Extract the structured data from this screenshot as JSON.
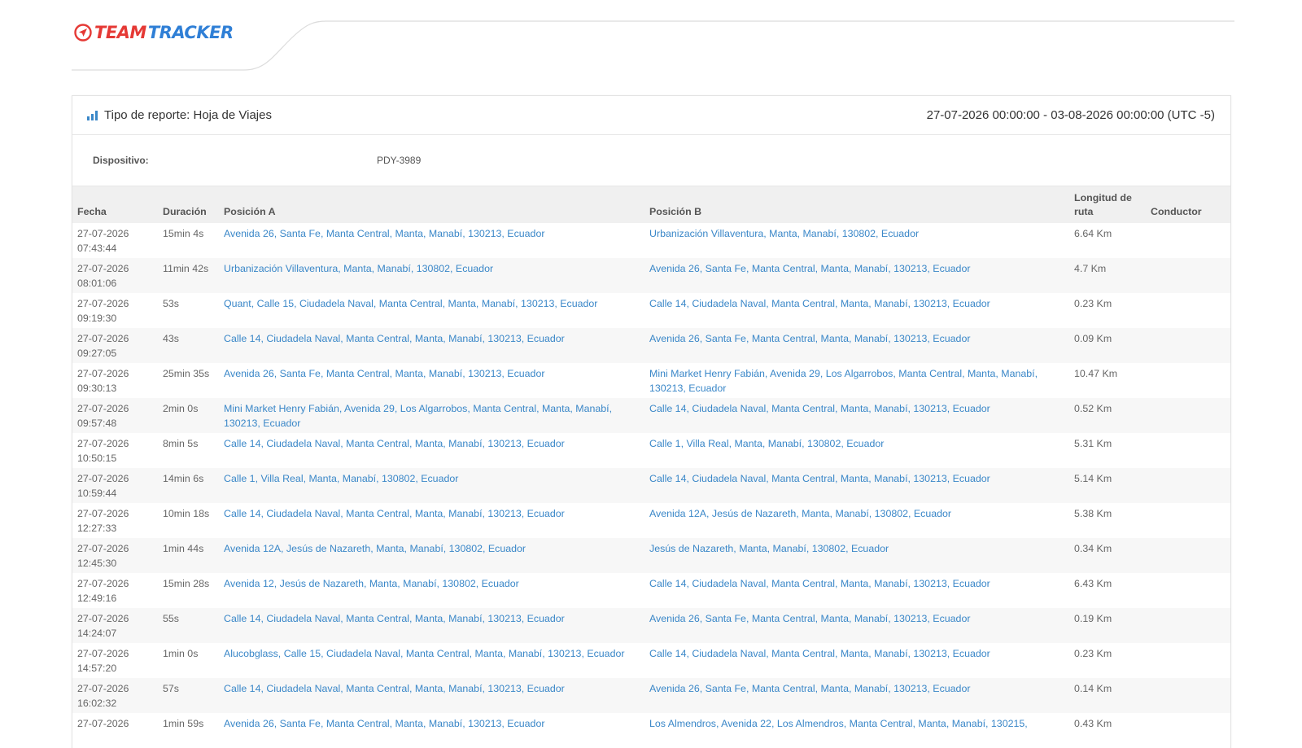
{
  "brand": {
    "part1": "TEAM",
    "part2": "TRACKER",
    "accent_red": "#e53935",
    "accent_blue": "#2f7fd6"
  },
  "report": {
    "type_label": "Tipo de reporte: Hoja de Viajes",
    "date_range": "27-07-2026 00:00:00 - 03-08-2026 00:00:00 (UTC -5)",
    "device_label": "Dispositivo:",
    "device_value": "PDY-3989"
  },
  "table": {
    "headers": {
      "fecha": "Fecha",
      "duracion": "Duración",
      "pos_a": "Posición A",
      "pos_b": "Posición B",
      "longitud_line1": "Longitud de",
      "longitud_line2": "ruta",
      "conductor": "Conductor"
    },
    "rows": [
      {
        "date": "27-07-2026",
        "time": "07:43:44",
        "dur": "15min 4s",
        "a": "Avenida 26, Santa Fe, Manta Central, Manta, Manabí, 130213, Ecuador",
        "b": "Urbanización Villaventura, Manta, Manabí, 130802, Ecuador",
        "len": "6.64 Km",
        "cond": ""
      },
      {
        "date": "27-07-2026",
        "time": "08:01:06",
        "dur": "11min 42s",
        "a": "Urbanización Villaventura, Manta, Manabí, 130802, Ecuador",
        "b": "Avenida 26, Santa Fe, Manta Central, Manta, Manabí, 130213, Ecuador",
        "len": "4.7 Km",
        "cond": ""
      },
      {
        "date": "27-07-2026",
        "time": "09:19:30",
        "dur": "53s",
        "a": "Quant, Calle 15, Ciudadela Naval, Manta Central, Manta, Manabí, 130213, Ecuador",
        "b": "Calle 14, Ciudadela Naval, Manta Central, Manta, Manabí, 130213, Ecuador",
        "len": "0.23 Km",
        "cond": ""
      },
      {
        "date": "27-07-2026",
        "time": "09:27:05",
        "dur": "43s",
        "a": "Calle 14, Ciudadela Naval, Manta Central, Manta, Manabí, 130213, Ecuador",
        "b": "Avenida 26, Santa Fe, Manta Central, Manta, Manabí, 130213, Ecuador",
        "len": "0.09 Km",
        "cond": ""
      },
      {
        "date": "27-07-2026",
        "time": "09:30:13",
        "dur": "25min 35s",
        "a": "Avenida 26, Santa Fe, Manta Central, Manta, Manabí, 130213, Ecuador",
        "b": "Mini Market Henry Fabián, Avenida 29, Los Algarrobos, Manta Central, Manta, Manabí, 130213, Ecuador",
        "len": "10.47 Km",
        "cond": ""
      },
      {
        "date": "27-07-2026",
        "time": "09:57:48",
        "dur": "2min 0s",
        "a": "Mini Market Henry Fabián, Avenida 29, Los Algarrobos, Manta Central, Manta, Manabí, 130213, Ecuador",
        "b": "Calle 14, Ciudadela Naval, Manta Central, Manta, Manabí, 130213, Ecuador",
        "len": "0.52 Km",
        "cond": ""
      },
      {
        "date": "27-07-2026",
        "time": "10:50:15",
        "dur": "8min 5s",
        "a": "Calle 14, Ciudadela Naval, Manta Central, Manta, Manabí, 130213, Ecuador",
        "b": "Calle 1, Villa Real, Manta, Manabí, 130802, Ecuador",
        "len": "5.31 Km",
        "cond": ""
      },
      {
        "date": "27-07-2026",
        "time": "10:59:44",
        "dur": "14min 6s",
        "a": "Calle 1, Villa Real, Manta, Manabí, 130802, Ecuador",
        "b": "Calle 14, Ciudadela Naval, Manta Central, Manta, Manabí, 130213, Ecuador",
        "len": "5.14 Km",
        "cond": ""
      },
      {
        "date": "27-07-2026",
        "time": "12:27:33",
        "dur": "10min 18s",
        "a": "Calle 14, Ciudadela Naval, Manta Central, Manta, Manabí, 130213, Ecuador",
        "b": "Avenida 12A, Jesús de Nazareth, Manta, Manabí, 130802, Ecuador",
        "len": "5.38 Km",
        "cond": ""
      },
      {
        "date": "27-07-2026",
        "time": "12:45:30",
        "dur": "1min 44s",
        "a": "Avenida 12A, Jesús de Nazareth, Manta, Manabí, 130802, Ecuador",
        "b": "Jesús de Nazareth, Manta, Manabí, 130802, Ecuador",
        "len": "0.34 Km",
        "cond": ""
      },
      {
        "date": "27-07-2026",
        "time": "12:49:16",
        "dur": "15min 28s",
        "a": "Avenida 12, Jesús de Nazareth, Manta, Manabí, 130802, Ecuador",
        "b": "Calle 14, Ciudadela Naval, Manta Central, Manta, Manabí, 130213, Ecuador",
        "len": "6.43 Km",
        "cond": ""
      },
      {
        "date": "27-07-2026",
        "time": "14:24:07",
        "dur": "55s",
        "a": "Calle 14, Ciudadela Naval, Manta Central, Manta, Manabí, 130213, Ecuador",
        "b": "Avenida 26, Santa Fe, Manta Central, Manta, Manabí, 130213, Ecuador",
        "len": "0.19 Km",
        "cond": ""
      },
      {
        "date": "27-07-2026",
        "time": "14:57:20",
        "dur": "1min 0s",
        "a": "Alucobglass, Calle 15, Ciudadela Naval, Manta Central, Manta, Manabí, 130213, Ecuador",
        "b": "Calle 14, Ciudadela Naval, Manta Central, Manta, Manabí, 130213, Ecuador",
        "len": "0.23 Km",
        "cond": ""
      },
      {
        "date": "27-07-2026",
        "time": "16:02:32",
        "dur": "57s",
        "a": "Calle 14, Ciudadela Naval, Manta Central, Manta, Manabí, 130213, Ecuador",
        "b": "Avenida 26, Santa Fe, Manta Central, Manta, Manabí, 130213, Ecuador",
        "len": "0.14 Km",
        "cond": ""
      },
      {
        "date": "27-07-2026",
        "time": "",
        "dur": "1min 59s",
        "a": "Avenida 26, Santa Fe, Manta Central, Manta, Manabí, 130213, Ecuador",
        "b": "Los Almendros, Avenida 22, Los Almendros, Manta Central, Manta, Manabí, 130215,",
        "len": "0.43 Km",
        "cond": ""
      }
    ]
  }
}
